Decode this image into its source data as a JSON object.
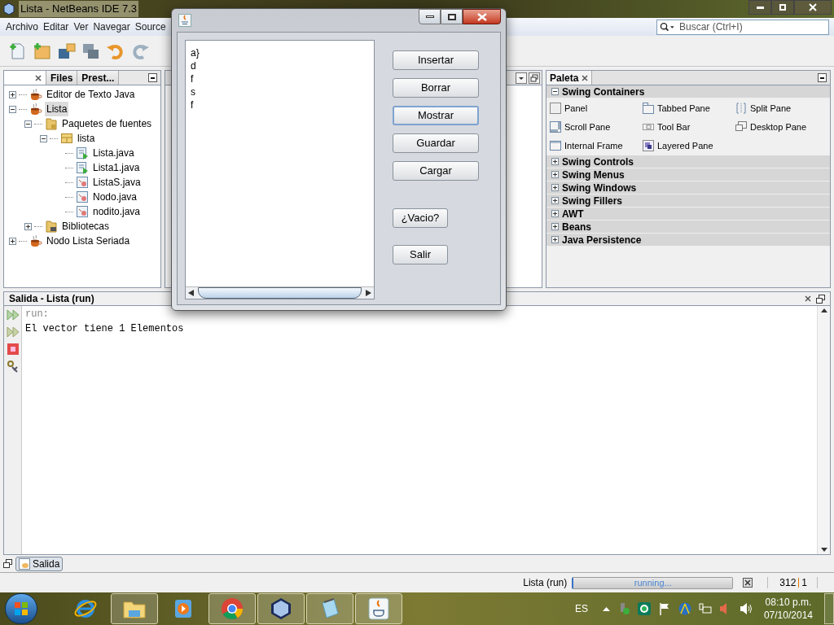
{
  "window": {
    "title": "Lista - NetBeans IDE 7.3"
  },
  "menu": [
    "Archivo",
    "Editar",
    "Ver",
    "Navegar",
    "Source"
  ],
  "search": {
    "placeholder": "Buscar (Ctrl+I)"
  },
  "projects": {
    "tabs": [
      {
        "selected": true
      },
      {
        "label": "Files",
        "selected": false
      },
      {
        "label": "Prest...",
        "selected": false
      }
    ],
    "tree": [
      {
        "label": "Editor de Texto Java",
        "kind": "project",
        "expanded": false,
        "selected": false
      },
      {
        "label": "Lista",
        "kind": "project",
        "expanded": true,
        "selected": true,
        "children": [
          {
            "label": "Paquetes de fuentes",
            "kind": "sources",
            "expanded": true,
            "selected": false,
            "children": [
              {
                "label": "lista",
                "kind": "package",
                "expanded": true,
                "selected": false,
                "children": [
                  {
                    "label": "Lista.java",
                    "kind": "main_class",
                    "selected": false
                  },
                  {
                    "label": "Lista1.java",
                    "kind": "main_form",
                    "selected": false
                  },
                  {
                    "label": "ListaS.java",
                    "kind": "class",
                    "selected": false
                  },
                  {
                    "label": "Nodo.java",
                    "kind": "class",
                    "selected": false
                  },
                  {
                    "label": "nodito.java",
                    "kind": "class",
                    "selected": false
                  }
                ]
              }
            ]
          },
          {
            "label": "Bibliotecas",
            "kind": "libraries",
            "expanded": false,
            "selected": false
          }
        ]
      },
      {
        "label": "Nodo Lista Seriada",
        "kind": "project",
        "expanded": false,
        "selected": false
      }
    ]
  },
  "palette": {
    "title": "Paleta",
    "categories": [
      {
        "label": "Swing Containers",
        "expanded": true,
        "items": [
          {
            "label": "Panel",
            "kind": "panel"
          },
          {
            "label": "Tabbed Pane",
            "kind": "tabbed"
          },
          {
            "label": "Split Pane",
            "kind": "split"
          },
          {
            "label": "Scroll Pane",
            "kind": "scroll"
          },
          {
            "label": "Tool Bar",
            "kind": "toolbar"
          },
          {
            "label": "Desktop Pane",
            "kind": "desktop"
          },
          {
            "label": "Internal Frame",
            "kind": "frame"
          },
          {
            "label": "Layered Pane",
            "kind": "layered"
          }
        ]
      },
      {
        "label": "Swing Controls",
        "expanded": false
      },
      {
        "label": "Swing Menus",
        "expanded": false
      },
      {
        "label": "Swing Windows",
        "expanded": false
      },
      {
        "label": "Swing Fillers",
        "expanded": false
      },
      {
        "label": "AWT",
        "expanded": false
      },
      {
        "label": "Beans",
        "expanded": false
      },
      {
        "label": "Java Persistence",
        "expanded": false
      }
    ]
  },
  "output": {
    "title": "Salida - Lista (run)",
    "lines": [
      {
        "kind": "info",
        "text": "run:"
      },
      {
        "kind": "normal",
        "text": "El vector tiene 1 Elementos"
      }
    ]
  },
  "bottom_tabs": [
    {
      "label": "Salida",
      "selected": true
    }
  ],
  "status": {
    "task": "Lista (run)",
    "progress": "running...",
    "level": 1,
    "line": "312",
    "column": "1"
  },
  "dialog": {
    "items": [
      "a}",
      "d",
      "f",
      "s",
      "f"
    ],
    "buttons": [
      {
        "label": "Insertar",
        "focused": false
      },
      {
        "label": "Borrar",
        "focused": false
      },
      {
        "label": "Mostrar",
        "focused": true
      },
      {
        "label": "Guardar",
        "focused": false
      },
      {
        "label": "Cargar",
        "focused": false
      }
    ],
    "small_buttons": [
      {
        "label": "¿Vacio?",
        "focused": false
      },
      {
        "label": "Salir",
        "focused": false
      }
    ]
  },
  "taskbar": {
    "apps": [
      {
        "kind": "ie",
        "running": false
      },
      {
        "kind": "explorer",
        "running": true
      },
      {
        "kind": "media",
        "running": false
      },
      {
        "kind": "chrome",
        "running": true
      },
      {
        "kind": "netbeans",
        "running": true
      },
      {
        "kind": "notepad",
        "running": true
      },
      {
        "kind": "java",
        "running": true
      }
    ],
    "language": "ES",
    "time": "08:10 p.m.",
    "date": "07/10/2014"
  }
}
